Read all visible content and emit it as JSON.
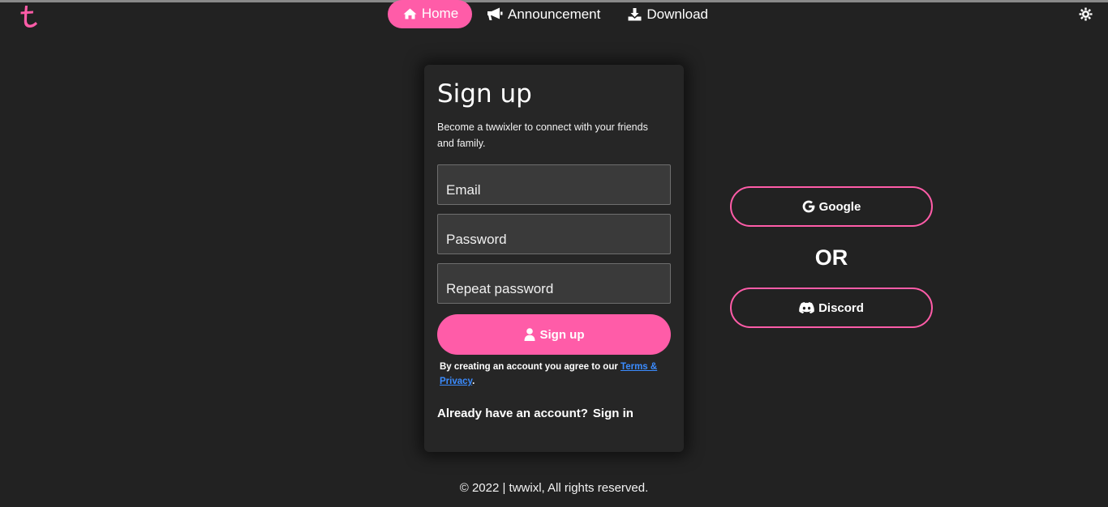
{
  "nav": {
    "items": [
      {
        "label": "Home",
        "icon": "home-icon",
        "active": true
      },
      {
        "label": "Announcement",
        "icon": "megaphone-icon",
        "active": false
      },
      {
        "label": "Download",
        "icon": "download-icon",
        "active": false
      }
    ],
    "theme_icon": "gear-icon"
  },
  "signup": {
    "title": "Sign up",
    "subtitle": "Become a twwixler to connect with your friends and family.",
    "email_placeholder": "Email",
    "password_placeholder": "Password",
    "repeat_placeholder": "Repeat password",
    "button_label": "Sign up",
    "terms_prefix": "By creating an account you agree to our",
    "terms_link": "Terms & Privacy",
    "terms_suffix": ".",
    "already_text": "Already have an account?",
    "signin_label": "Sign in"
  },
  "social": {
    "google_label": "Google",
    "or_text": "OR",
    "discord_label": "Discord"
  },
  "footer": {
    "text": "© 2022 | twwixl, All rights reserved."
  },
  "colors": {
    "background": "#222222",
    "card": "#262626",
    "accent": "#ff5ca8",
    "link": "#3b8cff"
  }
}
